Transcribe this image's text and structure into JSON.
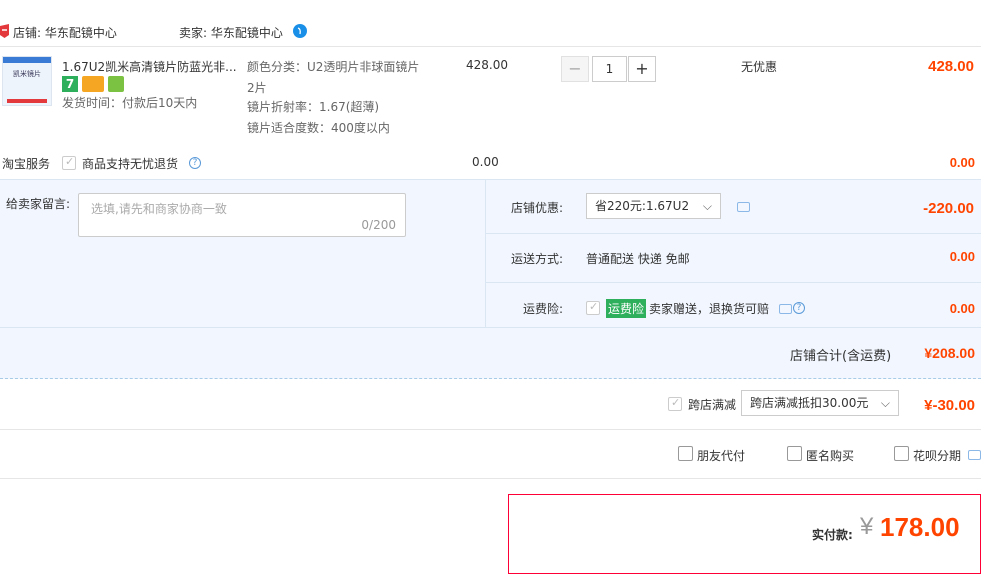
{
  "header": {
    "shop_label": "店铺: 华东配镜中心",
    "seller_label": "卖家: 华东配镜中心"
  },
  "item": {
    "thumb_text": "凯米镜片",
    "title": "1.67U2凯米高清镜片防蓝光非...",
    "ship_time": "发货时间：付款后10天内",
    "sku_color_line1": "颜色分类：U2透明片非球面镜片",
    "sku_color_line2": "2片",
    "sku_index": "镜片折射率：1.67(超薄)",
    "sku_degree": "镜片适合度数：400度以内",
    "unit_price": "428.00",
    "quantity": "1",
    "discount": "无优惠",
    "subtotal": "428.00"
  },
  "service": {
    "label": "淘宝服务",
    "option": "商品支持无忧退货",
    "price": "0.00",
    "total": "0.00"
  },
  "message": {
    "label": "给卖家留言:",
    "placeholder": "选填,请先和商家协商一致",
    "count": "0/200"
  },
  "shop_discount": {
    "label": "店铺优惠:",
    "selected": "省220元:1.67U2",
    "amount": "-220.00"
  },
  "shipping": {
    "label": "运送方式:",
    "value": "普通配送 快递 免邮",
    "amount": "0.00"
  },
  "insurance": {
    "label": "运费险:",
    "badge": "运费险",
    "desc": "卖家赠送，退换货可赔",
    "amount": "0.00"
  },
  "shop_total": {
    "label": "店铺合计(含运费)",
    "amount": "¥208.00"
  },
  "cross_store": {
    "label": "跨店满减",
    "selected": "跨店满减抵扣30.00元",
    "amount": "¥-30.00"
  },
  "options": {
    "friend_pay": "朋友代付",
    "anonymous": "匿名购买",
    "huabei": "花呗分期"
  },
  "payment": {
    "label": "实付款:",
    "currency": "¥",
    "amount": "178.00"
  },
  "colors": {
    "accent": "#ff4400",
    "panel_bg": "#f2f7ff",
    "badge_green": "#2eaf5c"
  }
}
